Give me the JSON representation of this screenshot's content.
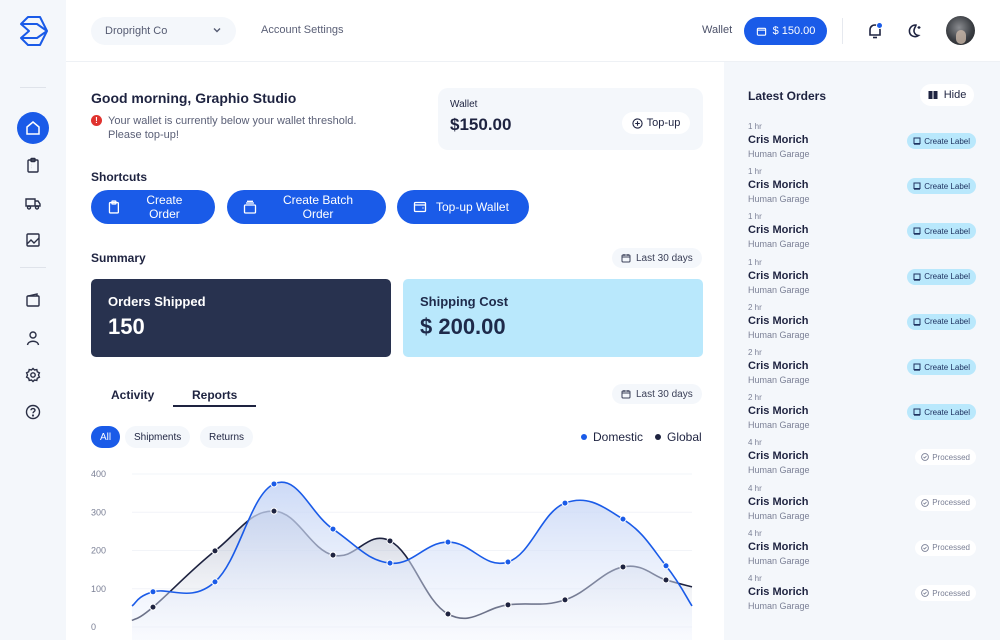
{
  "sidebar": {
    "logo": "box-logo-icon",
    "items": [
      {
        "name": "home",
        "icon": "home-icon",
        "active": true
      },
      {
        "name": "orders",
        "icon": "clipboard-icon",
        "active": false
      },
      {
        "name": "shipments",
        "icon": "truck-icon",
        "active": false
      },
      {
        "name": "reports",
        "icon": "chart-image-icon",
        "active": false
      },
      {
        "name": "wallet",
        "icon": "wallet-icon",
        "active": false
      },
      {
        "name": "profile",
        "icon": "user-icon",
        "active": false
      },
      {
        "name": "settings",
        "icon": "gear-icon",
        "active": false
      },
      {
        "name": "help",
        "icon": "help-icon",
        "active": false
      }
    ]
  },
  "topbar": {
    "company": "Dropright Co",
    "account_settings": "Account Settings",
    "wallet_label": "Wallet",
    "wallet_amount": "$ 150.00",
    "notification_count": "1"
  },
  "main": {
    "greeting": "Good morning, Graphio Studio",
    "alert": "Your wallet is currently below your wallet threshold. Please top-up!",
    "alert_icon": "!",
    "wallet_card": {
      "label": "Wallet",
      "amount": "$150.00",
      "topup_label": "Top-up"
    },
    "shortcuts_title": "Shortcuts",
    "shortcuts": [
      {
        "label": "Create Order",
        "icon": "clipboard-icon"
      },
      {
        "label": "Create Batch Order",
        "icon": "stack-icon"
      },
      {
        "label": "Top-up Wallet",
        "icon": "wallet-icon"
      }
    ],
    "summary_title": "Summary",
    "summary_range": "Last 30 days",
    "orders_shipped": {
      "label": "Orders Shipped",
      "value": "150"
    },
    "shipping_cost": {
      "label": "Shipping Cost",
      "value": "$ 200.00"
    },
    "tabs": [
      {
        "label": "Activity",
        "active": false
      },
      {
        "label": "Reports",
        "active": true
      }
    ],
    "reports_range": "Last 30 days",
    "filters": [
      {
        "label": "All",
        "active": true
      },
      {
        "label": "Shipments",
        "active": false
      },
      {
        "label": "Returns",
        "active": false
      }
    ],
    "legend": [
      {
        "label": "Domestic",
        "color": "#1a5be8"
      },
      {
        "label": "Global",
        "color": "#1e2340"
      }
    ]
  },
  "chart_data": {
    "type": "area",
    "title": "",
    "xlabel": "",
    "ylabel": "",
    "ylim": [
      0,
      400
    ],
    "yticks": [
      "0",
      "100",
      "200",
      "300",
      "400"
    ],
    "grid": true,
    "legend_position": "top-right",
    "series": [
      {
        "name": "Domestic",
        "color": "#1a5be8",
        "start": 55,
        "end": 55,
        "values": [
          92,
          118,
          374,
          256,
          167,
          222,
          170,
          324,
          282,
          160
        ]
      },
      {
        "name": "Global",
        "color": "#1e2340",
        "start": 17,
        "end": 105,
        "values": [
          52,
          199,
          303,
          188,
          225,
          34,
          58,
          71,
          157,
          123
        ]
      }
    ]
  },
  "right_panel": {
    "title": "Latest Orders",
    "hide_label": "Hide",
    "orders": [
      {
        "time": "1 hr",
        "name": "Cris Morich",
        "company": "Human Garage",
        "action": "Create Label",
        "status": "create"
      },
      {
        "time": "1 hr",
        "name": "Cris Morich",
        "company": "Human Garage",
        "action": "Create Label",
        "status": "create"
      },
      {
        "time": "1 hr",
        "name": "Cris Morich",
        "company": "Human Garage",
        "action": "Create Label",
        "status": "create"
      },
      {
        "time": "1 hr",
        "name": "Cris Morich",
        "company": "Human Garage",
        "action": "Create Label",
        "status": "create"
      },
      {
        "time": "2 hr",
        "name": "Cris Morich",
        "company": "Human Garage",
        "action": "Create Label",
        "status": "create"
      },
      {
        "time": "2 hr",
        "name": "Cris Morich",
        "company": "Human Garage",
        "action": "Create Label",
        "status": "create"
      },
      {
        "time": "2 hr",
        "name": "Cris Morich",
        "company": "Human Garage",
        "action": "Create Label",
        "status": "create"
      },
      {
        "time": "4 hr",
        "name": "Cris Morich",
        "company": "Human Garage",
        "action": "Processed",
        "status": "processed"
      },
      {
        "time": "4 hr",
        "name": "Cris Morich",
        "company": "Human Garage",
        "action": "Processed",
        "status": "processed"
      },
      {
        "time": "4 hr",
        "name": "Cris Morich",
        "company": "Human Garage",
        "action": "Processed",
        "status": "processed"
      },
      {
        "time": "4 hr",
        "name": "Cris Morich",
        "company": "Human Garage",
        "action": "Processed",
        "status": "processed"
      }
    ]
  }
}
